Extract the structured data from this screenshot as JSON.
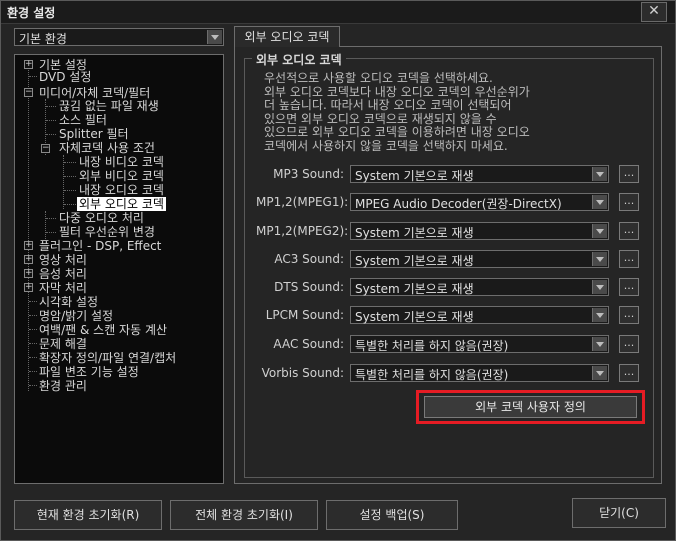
{
  "window": {
    "title": "환경 설정",
    "close": "✕"
  },
  "preset": {
    "value": "기본 환경"
  },
  "tree": [
    {
      "label": "기본 설정"
    },
    {
      "label": "DVD 설정"
    },
    {
      "label": "미디어/자체 코덱/필터"
    },
    {
      "label": "끊김 없는 파일 재생"
    },
    {
      "label": "소스 필터"
    },
    {
      "label": "Splitter 필터"
    },
    {
      "label": "자체코덱 사용 조건"
    },
    {
      "label": "내장 비디오 코덱"
    },
    {
      "label": "외부 비디오 코덱"
    },
    {
      "label": "내장 오디오 코덱"
    },
    {
      "label": "외부 오디오 코덱"
    },
    {
      "label": "다중 오디오 처리"
    },
    {
      "label": "필터 우선순위 변경"
    },
    {
      "label": "플러그인 - DSP, Effect"
    },
    {
      "label": "영상 처리"
    },
    {
      "label": "음성 처리"
    },
    {
      "label": "자막 처리"
    },
    {
      "label": "시각화 설정"
    },
    {
      "label": "명암/밝기 설정"
    },
    {
      "label": "여백/팬 & 스캔 자동 계산"
    },
    {
      "label": "문제 해결"
    },
    {
      "label": "확장자 정의/파일 연결/캡처"
    },
    {
      "label": "파일 변조 기능 설정"
    },
    {
      "label": "환경 관리"
    }
  ],
  "tab": {
    "label": "외부 오디오 코덱"
  },
  "group": {
    "title": "외부 오디오 코덱",
    "desc": [
      "우선적으로 사용할 오디오 코덱을 선택하세요.",
      "외부 오디오 코덱보다 내장 오디오 코덱의 우선순위가",
      "더 높습니다. 따라서 내장 오디오 코덱이 선택되어",
      "있으면 외부 오디오 코덱으로 재생되지 않을 수",
      "있으므로 외부 오디오 코덱을 이용하려면 내장 오디오",
      "코덱에서 사용하지 않을 코덱을 선택하지 마세요."
    ]
  },
  "codecs": [
    {
      "label": "MP3 Sound:",
      "value": "System 기본으로 재생"
    },
    {
      "label": "MP1,2(MPEG1):",
      "value": "MPEG Audio Decoder(권장-DirectX)"
    },
    {
      "label": "MP1,2(MPEG2):",
      "value": "System 기본으로 재생"
    },
    {
      "label": "AC3 Sound:",
      "value": "System 기본으로 재생"
    },
    {
      "label": "DTS Sound:",
      "value": "System 기본으로 재생"
    },
    {
      "label": "LPCM Sound:",
      "value": "System 기본으로 재생"
    },
    {
      "label": "AAC Sound:",
      "value": "특별한 처리를 하지 않음(권장)"
    },
    {
      "label": "Vorbis Sound:",
      "value": "특별한 처리를 하지 않음(권장)"
    }
  ],
  "dots_label": "...",
  "custom_button": "외부 코덱 사용자 정의",
  "buttons": {
    "reset_current": "현재 환경 초기화(R)",
    "reset_all": "전체 환경 초기화(I)",
    "backup": "설정 백업(S)",
    "close": "닫기(C)"
  },
  "highlight_color": "#e61c24"
}
